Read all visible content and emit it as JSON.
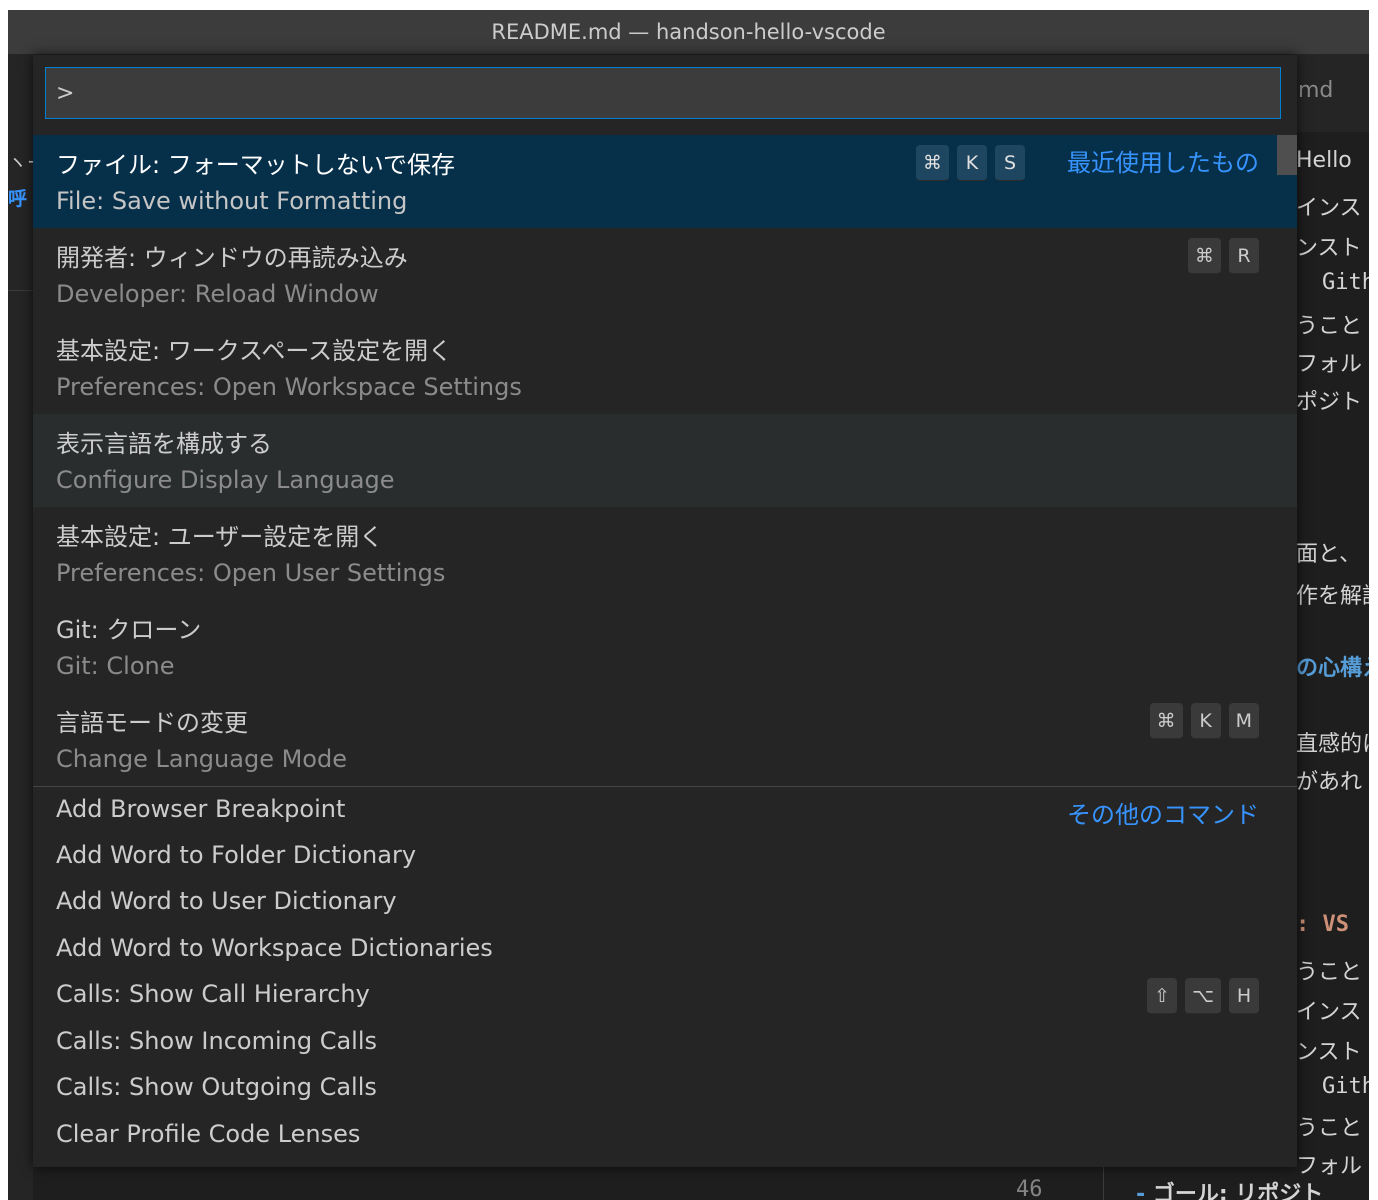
{
  "window": {
    "title": "README.md — handson-hello-vscode"
  },
  "tabs": {
    "right_tab_fragment": "md"
  },
  "editor_left": {
    "fragment1": "ヽー",
    "fragment2": "呼"
  },
  "editor_right_lines": [
    "Hello",
    "インス",
    "ンスト",
    "Gith",
    "うこと",
    "フォル",
    "ポジト",
    "面と、",
    "作を解説",
    "の心構え",
    "直感的に",
    "があれ",
    ": VS",
    "うこと",
    "インス",
    "ンスト",
    "Gith",
    "うこと",
    "フォル"
  ],
  "editor_bottom": {
    "line_number": "46",
    "dash": "-",
    "text": "ゴール: リポジト"
  },
  "palette": {
    "input_value": ">",
    "items": [
      {
        "label": "ファイル: フォーマットしないで保存",
        "detail": "File: Save without Formatting",
        "keys": [
          "⌘",
          "K",
          "S"
        ],
        "group": "最近使用したもの"
      },
      {
        "label": "開発者: ウィンドウの再読み込み",
        "detail": "Developer: Reload Window",
        "keys": [
          "⌘",
          "R"
        ]
      },
      {
        "label": "基本設定: ワークスペース設定を開く",
        "detail": "Preferences: Open Workspace Settings",
        "keys": []
      },
      {
        "label": "表示言語を構成する",
        "detail": "Configure Display Language",
        "keys": []
      },
      {
        "label": "基本設定: ユーザー設定を開く",
        "detail": "Preferences: Open User Settings",
        "keys": []
      },
      {
        "label": "Git: クローン",
        "detail": "Git: Clone",
        "keys": []
      },
      {
        "label": "言語モードの変更",
        "detail": "Change Language Mode",
        "keys": [
          "⌘",
          "K",
          "M"
        ]
      }
    ],
    "other_group_label": "その他のコマンド",
    "other_items": [
      {
        "label": "Add Browser Breakpoint",
        "keys": []
      },
      {
        "label": "Add Word to Folder Dictionary",
        "keys": []
      },
      {
        "label": "Add Word to User Dictionary",
        "keys": []
      },
      {
        "label": "Add Word to Workspace Dictionaries",
        "keys": []
      },
      {
        "label": "Calls: Show Call Hierarchy",
        "keys": [
          "⇧",
          "⌥",
          "H"
        ]
      },
      {
        "label": "Calls: Show Incoming Calls",
        "keys": []
      },
      {
        "label": "Calls: Show Outgoing Calls",
        "keys": []
      },
      {
        "label": "Clear Profile Code Lenses",
        "keys": []
      }
    ]
  }
}
